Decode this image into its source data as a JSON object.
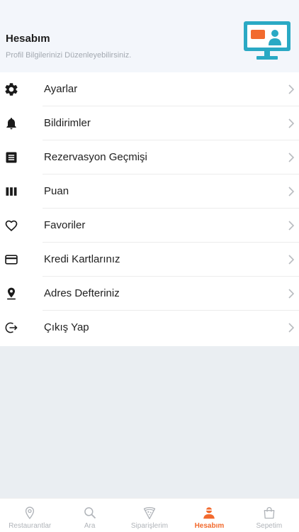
{
  "header": {
    "title": "Hesabım",
    "subtitle": "Profil Bilgilerinizi Düzenleyebilirsiniz."
  },
  "menu": {
    "items": [
      {
        "label": "Ayarlar",
        "icon": "gear-icon"
      },
      {
        "label": "Bildirimler",
        "icon": "bell-icon"
      },
      {
        "label": "Rezervasyon Geçmişi",
        "icon": "list-icon"
      },
      {
        "label": "Puan",
        "icon": "columns-icon"
      },
      {
        "label": "Favoriler",
        "icon": "heart-icon"
      },
      {
        "label": "Kredi Kartlarınız",
        "icon": "credit-card-icon"
      },
      {
        "label": "Adres Defteriniz",
        "icon": "location-pin-icon"
      },
      {
        "label": "Çıkış Yap",
        "icon": "logout-icon"
      }
    ]
  },
  "tabbar": {
    "active_index": 3,
    "active_color": "#f26a2e",
    "tabs": [
      {
        "label": "Restaurantlar",
        "icon": "map-pin-icon"
      },
      {
        "label": "Ara",
        "icon": "search-icon"
      },
      {
        "label": "Siparişlerim",
        "icon": "pizza-slice-icon"
      },
      {
        "label": "Hesabım",
        "icon": "user-icon"
      },
      {
        "label": "Sepetim",
        "icon": "shopping-bag-icon"
      }
    ]
  },
  "colors": {
    "header_bg": "#f3f6fb",
    "page_bg": "#eaeef2",
    "illustration_teal": "#2aa9c4",
    "illustration_orange": "#f26a2e"
  }
}
